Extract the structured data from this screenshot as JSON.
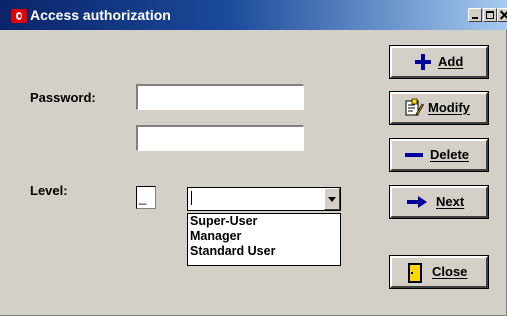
{
  "window": {
    "title": "Access authorization"
  },
  "form": {
    "password_label": "Password:",
    "password_value": "",
    "confirm_value": "",
    "level_label": "Level:",
    "level_value": "_",
    "level_combo_value": "",
    "level_options": [
      "Super-User",
      "Manager",
      "Standard User"
    ]
  },
  "buttons": {
    "add": "Add",
    "modify": "Modify",
    "delete": "Delete",
    "next": "Next",
    "close": "Close"
  },
  "icons": {
    "app": "app-red-icon",
    "add": "plus-icon",
    "modify": "edit-document-icon",
    "delete": "minus-icon",
    "next": "arrow-right-icon",
    "close": "exit-door-icon"
  },
  "colors": {
    "title_bar": "#0a246a",
    "window_bg": "#d4d0c8",
    "icon_blue": "#00009c"
  }
}
